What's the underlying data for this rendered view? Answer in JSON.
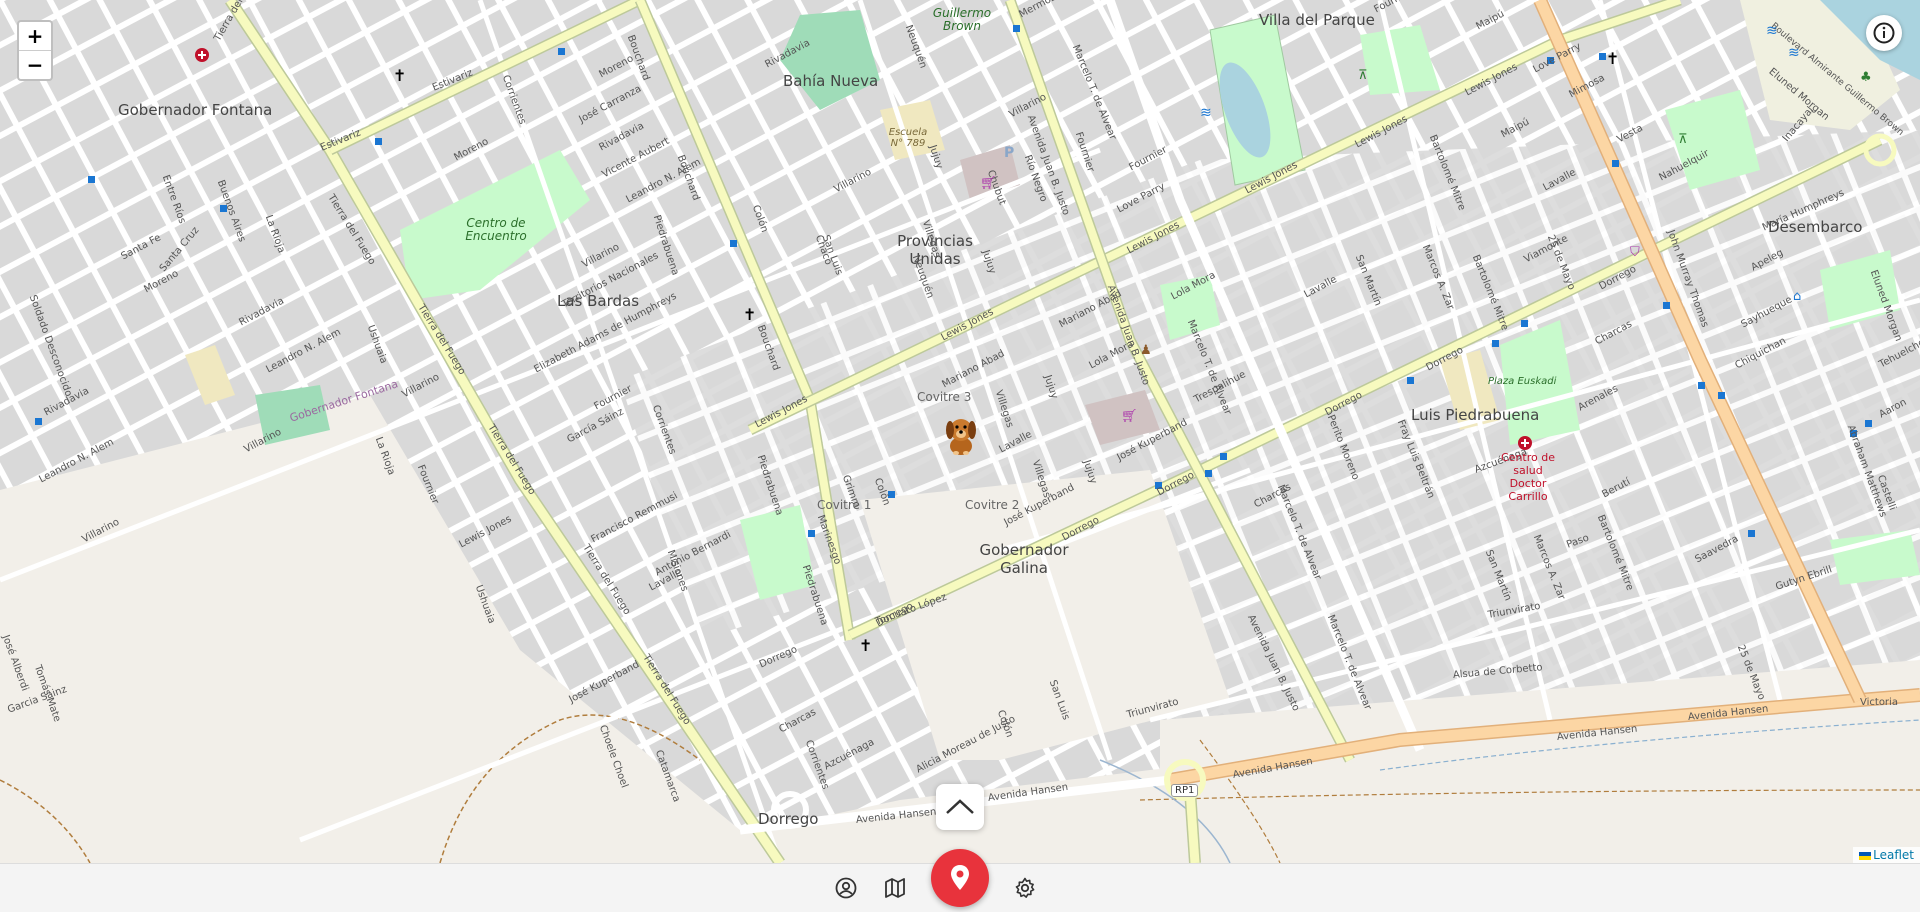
{
  "map": {
    "places": [
      {
        "name": "Gobernador Fontana"
      },
      {
        "name": "Las Bardas"
      },
      {
        "name": "Bahía Nueva"
      },
      {
        "name": "Provincias Unidas"
      },
      {
        "name": "Villa del Parque"
      },
      {
        "name": "Desembarco"
      },
      {
        "name": "Luis Piedrabuena"
      },
      {
        "name": "Gobernador Galina"
      },
      {
        "name": "Dorrego"
      },
      {
        "name": "Guillermo Brown"
      },
      {
        "name": "Centro de Encuentro"
      },
      {
        "name": "Covitre 3"
      },
      {
        "name": "Covitre 1"
      },
      {
        "name": "Covitre 2"
      },
      {
        "name": "Escuela N° 789"
      },
      {
        "name": "Plaza Euskadi"
      },
      {
        "name": "Gobernador Fontana"
      }
    ],
    "health_center": "Centro de salud Doctor Carrillo",
    "route_badge": "RP1",
    "streets": [
      "Estivariz",
      "Tierra del Fuego",
      "Bouchard",
      "Lewis Jones",
      "Dorrego",
      "Piedrabuena",
      "Avenida Juan B. Justo",
      "Avenida Hansen",
      "Colón",
      "Villarino",
      "Rivadavia",
      "Marcelo T. de Alvear",
      "Mariano Abad",
      "Jujuy",
      "Villegas",
      "Lola Mora",
      "José Kuperband",
      "Charcas",
      "Alsua de Corbetto",
      "Triunvirato",
      "Paso",
      "Berutí",
      "Arenales",
      "María Humphreys",
      "Love Parry",
      "Fournier",
      "Lavalle",
      "San Martín",
      "Moreno",
      "Corrientes",
      "Sarmiento",
      "Chiquichan",
      "Sayhueque",
      "Apeleg",
      "Saavedra",
      "Gutyn Ebrill",
      "Victoria",
      "Aaron",
      "Mimosa",
      "Vesta",
      "Nahuelquir",
      "Boulevard Almirante Guillermo Brown",
      "Torcuato López",
      "Alicia Moreau de Justo",
      "Azcuénaga",
      "Antonio Bernardi",
      "Lewis Jones",
      "Elizabeth Adams de Humphreys",
      "García Sáinz",
      "Francisco Remmusi",
      "Territorios Nacionales",
      "Leandro N. Alem",
      "Vicente Aubert",
      "José Carranza",
      "Uruguay",
      "Maipú",
      "Viamonte",
      "25 de Mayo",
      "Bartolomé Mitre",
      "Marcos A. Zar",
      "Fray Luis Beltrán",
      "Perito Moreno",
      "Trespalihue",
      "Buenos Aires",
      "Entre Ríos",
      "La Rioja",
      "Santa Fe",
      "Santa Cruz",
      "Soldado Desconocido",
      "Ushuaia",
      "Chubut",
      "Río Negro",
      "Neuquén",
      "San Luis",
      "Chaco",
      "Grimm",
      "Marinesgo",
      "Misiones",
      "Catamarca",
      "Choele Choel",
      "Tomás Mate",
      "José Alberdi",
      "Garcia Sainz",
      "Eluned Morgan",
      "John Murray Thomas",
      "Tehuelches",
      "Abraham Matthews",
      "Castelli",
      "Inacayal",
      "Fontana",
      "Belgrano",
      "Mermoz"
    ],
    "leaflet_label": "Leaflet",
    "zoom_in": "+",
    "zoom_out": "−"
  },
  "toolbar": {
    "items": [
      "profile-icon",
      "map-icon",
      "location-pin-icon",
      "settings-icon"
    ]
  },
  "colors": {
    "land": "#f2efe9",
    "residential": "#e0dfdf",
    "secondary_road": "#f7fabf",
    "primary_road": "#fcd6a4",
    "park": "#c8facc",
    "accent": "#e8333c"
  }
}
